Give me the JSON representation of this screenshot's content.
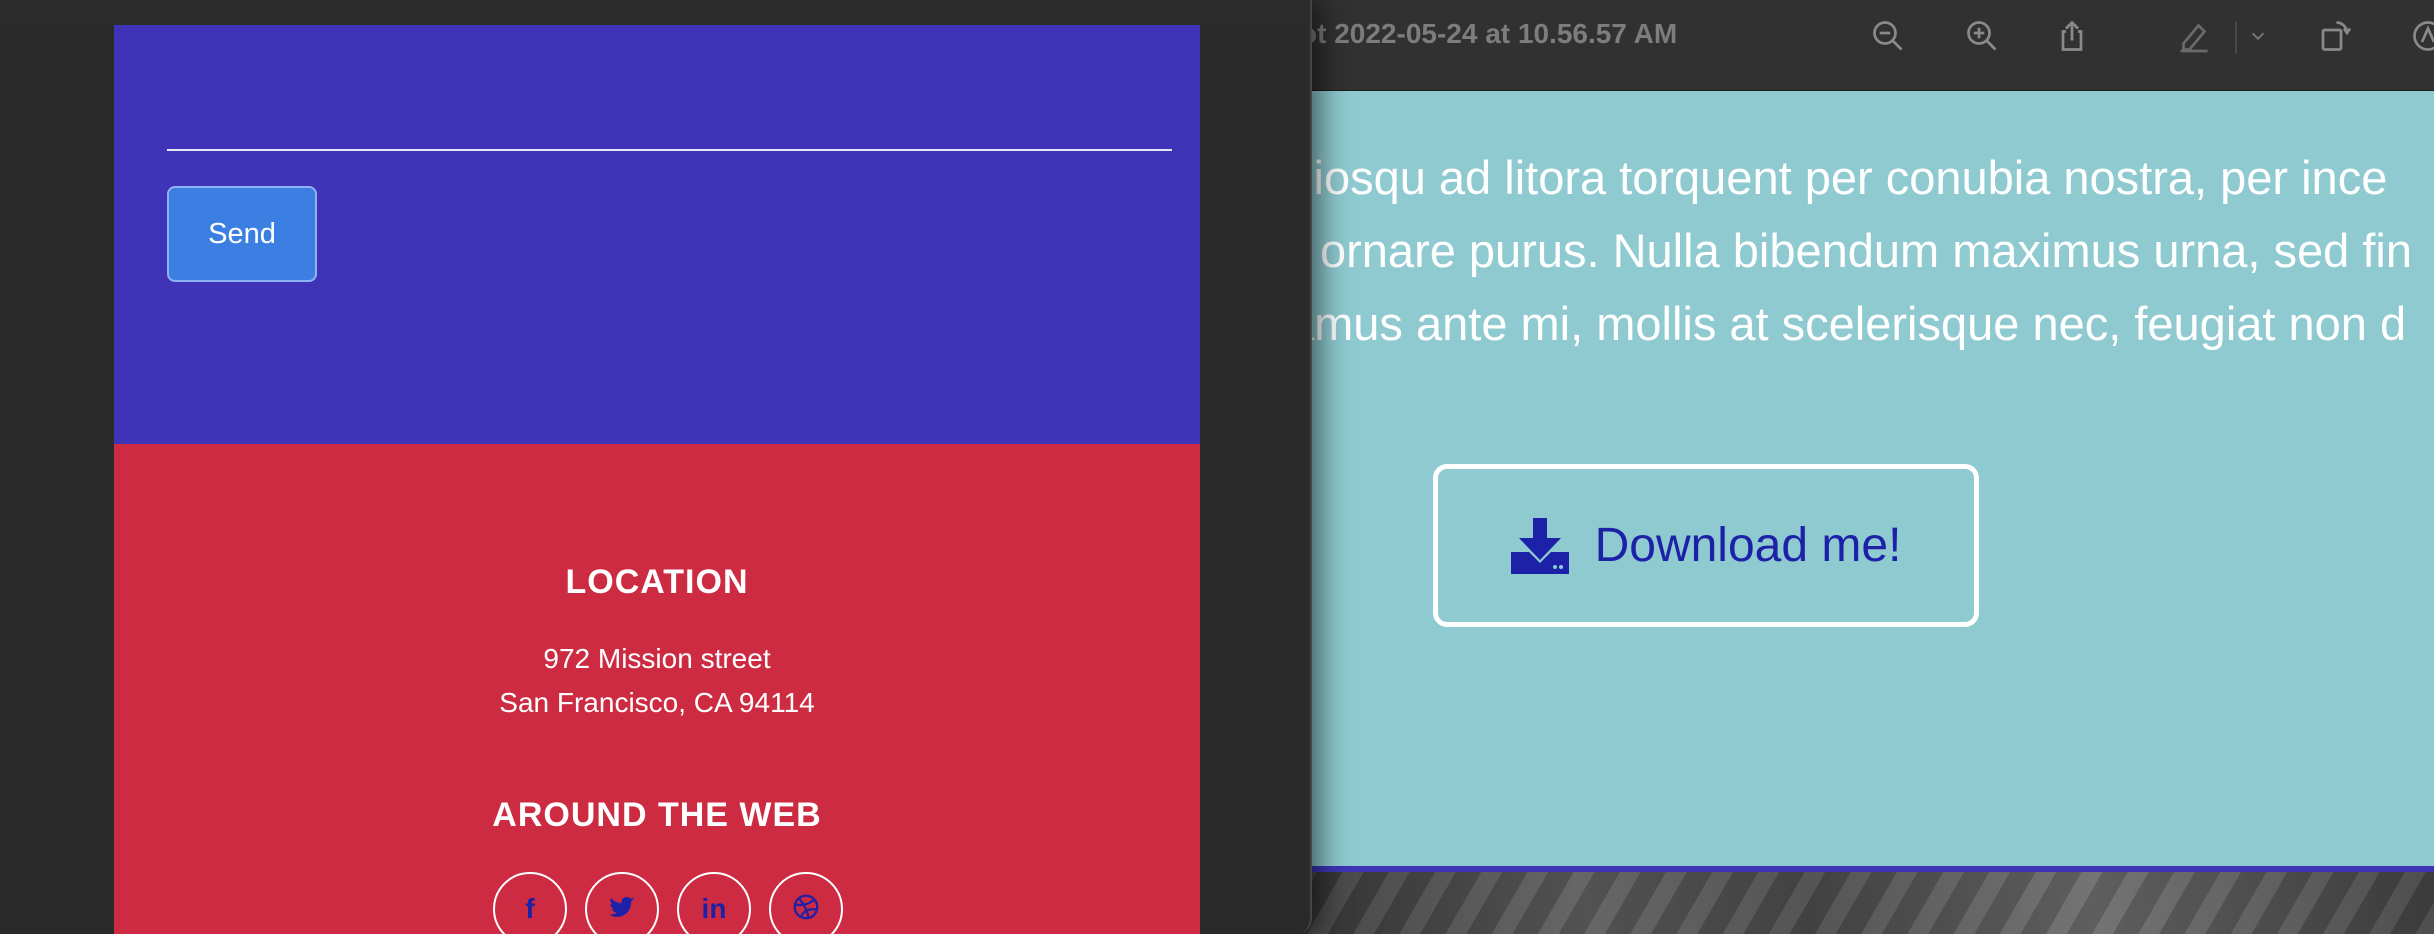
{
  "preview": {
    "title": "ot 2022-05-24 at 10.56.57 AM",
    "toolbar_icons": [
      "zoom-out-icon",
      "zoom-in-icon",
      "share-icon",
      "markup-pen-icon",
      "chevron-down-icon",
      "rotate-icon",
      "annotate-icon"
    ],
    "paragraph_lines": [
      "ciosqu ad litora torquent per conubia nostra, per ince",
      "ornare purus. Nulla bibendum maximus urna, sed fin",
      "amus ante mi, mollis at scelerisque nec, feugiat non d"
    ],
    "download_label": "Download me!",
    "download_icon": "download-icon"
  },
  "page": {
    "send_label": "Send",
    "location_heading": "LOCATION",
    "address_line1": "972 Mission street",
    "address_line2": "San Francisco, CA 94114",
    "around_heading": "AROUND THE WEB",
    "social": [
      {
        "name": "facebook-icon",
        "glyph": "f"
      },
      {
        "name": "twitter-icon",
        "glyph": ""
      },
      {
        "name": "linkedin-icon",
        "glyph": "in"
      },
      {
        "name": "dribbble-icon",
        "glyph": ""
      }
    ]
  },
  "colors": {
    "contact_bg": "#3f33b8",
    "footer_bg": "#cc2b42",
    "preview_bg": "#8ecad0",
    "accent_blue": "#1c21a8",
    "send_button": "#3c7fe3"
  }
}
